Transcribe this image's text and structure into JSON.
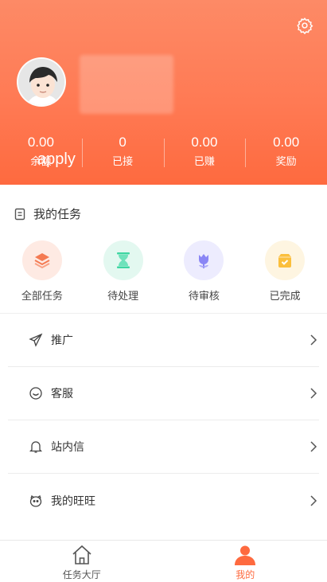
{
  "header": {
    "overlay_text": "apply",
    "stats": [
      {
        "value": "0.00",
        "label": "余额"
      },
      {
        "value": "0",
        "label": "已接"
      },
      {
        "value": "0.00",
        "label": "已赚"
      },
      {
        "value": "0.00",
        "label": "奖励"
      }
    ]
  },
  "tasks_section": {
    "title": "我的任务",
    "items": [
      {
        "label": "全部任务",
        "icon": "layers-icon",
        "color": "#f47a52"
      },
      {
        "label": "待处理",
        "icon": "hourglass-icon",
        "color": "#3ed6a2"
      },
      {
        "label": "待审核",
        "icon": "tulip-icon",
        "color": "#8a86f5"
      },
      {
        "label": "已完成",
        "icon": "bag-check-icon",
        "color": "#fbbf3c"
      }
    ]
  },
  "menu": [
    {
      "label": "推广",
      "icon": "send-icon"
    },
    {
      "label": "客服",
      "icon": "smile-icon"
    },
    {
      "label": "站内信",
      "icon": "bell-icon"
    },
    {
      "label": "我的旺旺",
      "icon": "wangwang-icon"
    }
  ],
  "tabbar": {
    "tabs": [
      {
        "label": "任务大厅",
        "icon": "home-icon",
        "active": false
      },
      {
        "label": "我的",
        "icon": "user-icon",
        "active": true
      }
    ],
    "active_color": "#fe6a3f",
    "inactive_color": "#555555"
  }
}
